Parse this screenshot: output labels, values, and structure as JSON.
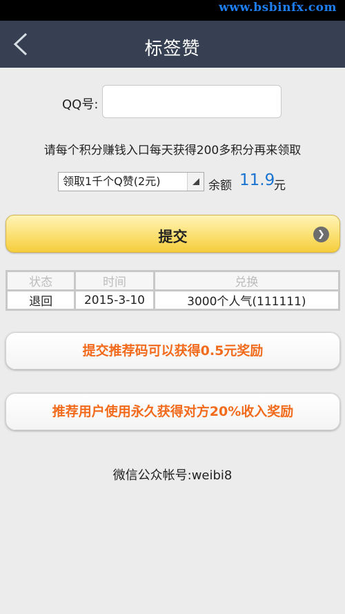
{
  "status_bar": {
    "watermark": "www.bsbinfx.com"
  },
  "header": {
    "title": "标签赞"
  },
  "form": {
    "qq_label": "QQ号:",
    "qq_value": "",
    "info_text": "请每个积分赚钱入口每天获得200多积分再来领取",
    "select_value": "领取1千个Q赞(2元)",
    "balance_label": "余额",
    "balance_value": "11.9",
    "balance_unit": "元"
  },
  "submit": {
    "label": "提交"
  },
  "records": {
    "headers": [
      "状态",
      "时间",
      "兑换"
    ],
    "rows": [
      [
        "退回",
        "2015-3-10",
        "3000个人气(111111)"
      ]
    ]
  },
  "promos": [
    {
      "label": "提交推荐码可以获得0.5元奖励"
    },
    {
      "label": "推荐用户使用永久获得对方20%收入奖励"
    }
  ],
  "footer": {
    "wechat": "微信公众帐号:weibi8"
  },
  "colors": {
    "header_bg": "#364052",
    "accent_blue": "#1a73d0",
    "promo_orange": "#f26a1b",
    "submit_yellow": "#fbe071"
  }
}
